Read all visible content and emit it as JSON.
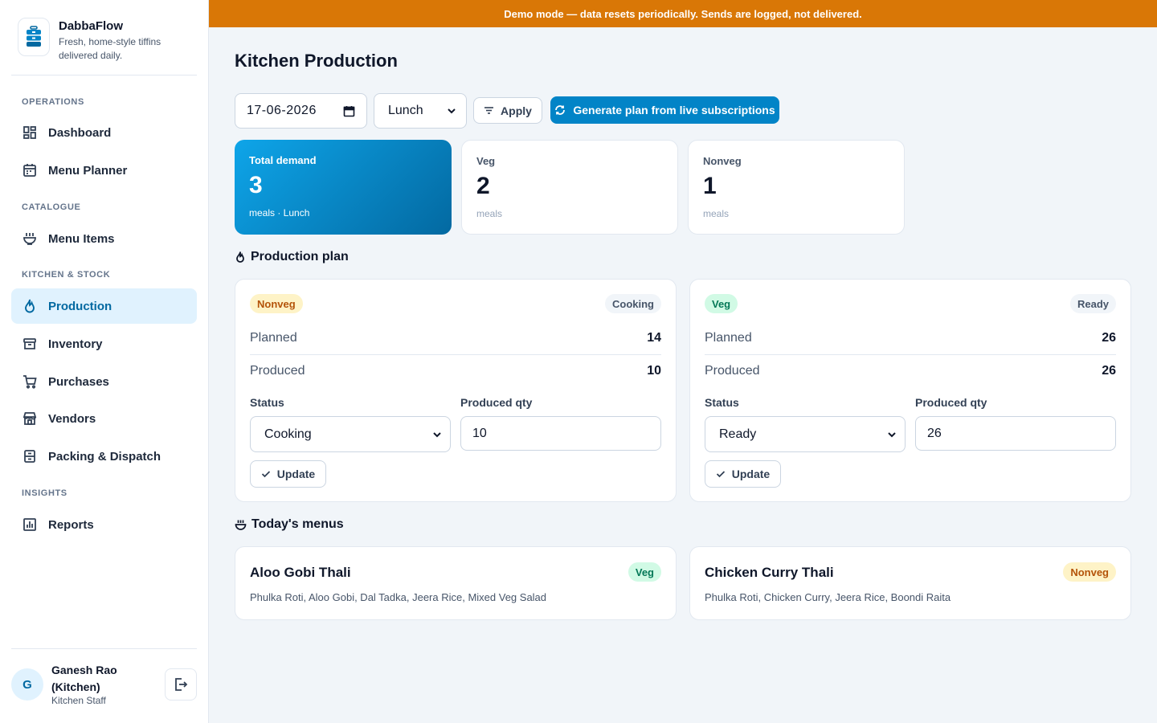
{
  "banner": {
    "text": "Demo mode — data resets periodically. Sends are logged, not delivered."
  },
  "brand": {
    "name": "DabbaFlow",
    "tagline": "Fresh, home-style tiffins delivered daily."
  },
  "nav": {
    "sections": {
      "operations": "OPERATIONS",
      "catalogue": "CATALOGUE",
      "kitchen": "KITCHEN & STOCK",
      "insights": "INSIGHTS"
    },
    "items": {
      "dashboard": "Dashboard",
      "menu_planner": "Menu Planner",
      "menu_items": "Menu Items",
      "production": "Production",
      "inventory": "Inventory",
      "purchases": "Purchases",
      "vendors": "Vendors",
      "packing": "Packing & Dispatch",
      "reports": "Reports"
    },
    "active": "production"
  },
  "user": {
    "initial": "G",
    "name": "Ganesh Rao (Kitchen)",
    "role": "Kitchen Staff"
  },
  "page": {
    "title": "Kitchen Production"
  },
  "filters": {
    "date": "17-06-2026",
    "meal": "Lunch",
    "apply_label": "Apply",
    "generate_label": "Generate plan from live subscriptions"
  },
  "stats": {
    "total": {
      "label": "Total demand",
      "value": "3",
      "sub": "meals · Lunch"
    },
    "veg": {
      "label": "Veg",
      "value": "2",
      "sub": "meals"
    },
    "nonveg": {
      "label": "Nonveg",
      "value": "1",
      "sub": "meals"
    }
  },
  "production_plan": {
    "title": "Production plan",
    "planned_label": "Planned",
    "produced_label": "Produced",
    "status_label": "Status",
    "qty_label": "Produced qty",
    "update_label": "Update",
    "cards": [
      {
        "type": "Nonveg",
        "status": "Cooking",
        "planned": "14",
        "produced": "10",
        "status_value": "Cooking",
        "qty": "10"
      },
      {
        "type": "Veg",
        "status": "Ready",
        "planned": "26",
        "produced": "26",
        "status_value": "Ready",
        "qty": "26"
      }
    ]
  },
  "menus": {
    "title": "Today's menus",
    "cards": [
      {
        "name": "Aloo Gobi Thali",
        "type": "Veg",
        "items": "Phulka Roti, Aloo Gobi, Dal Tadka, Jeera Rice, Mixed Veg Salad"
      },
      {
        "name": "Chicken Curry Thali",
        "type": "Nonveg",
        "items": "Phulka Roti, Chicken Curry, Jeera Rice, Boondi Raita"
      }
    ]
  },
  "colors": {
    "accent": "#0284c7",
    "banner": "#d97706",
    "veg": "#047857",
    "nonveg": "#b45309"
  },
  "icons": {
    "brand": "tiffin-icon",
    "dashboard": "dashboard-icon",
    "menu_planner": "calendar-icon",
    "menu_items": "bowl-icon",
    "production": "flame-icon",
    "inventory": "archive-icon",
    "purchases": "cart-icon",
    "vendors": "store-icon",
    "packing": "package-icon",
    "reports": "chart-icon",
    "logout": "logout-icon"
  }
}
